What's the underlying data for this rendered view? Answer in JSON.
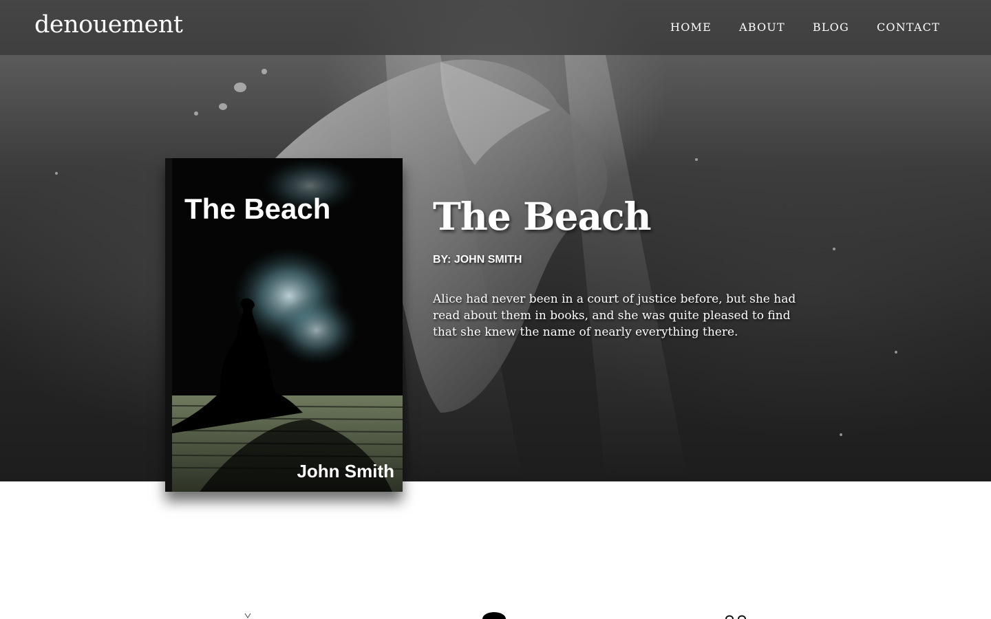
{
  "header": {
    "logo": "denouement",
    "nav": [
      {
        "label": "HOME"
      },
      {
        "label": "ABOUT"
      },
      {
        "label": "BLOG"
      },
      {
        "label": "CONTACT"
      }
    ]
  },
  "hero": {
    "background": "grayscale underwater photo of a person",
    "book": {
      "cover_title": "The Beach",
      "cover_author": "John Smith"
    },
    "title": "The Beach",
    "author_line": "BY: JOHN SMITH",
    "description": "Alice had never been in a court of justice before, but she had read about them in books, and she was quite pleased to find that she knew the name of nearly everything there."
  },
  "icons": {
    "bottom": [
      "feather-icon",
      "person-icon",
      "glasses-icon"
    ]
  },
  "colors": {
    "nav_bg": "#282828",
    "text": "#ffffff",
    "page_bg": "#ffffff"
  }
}
